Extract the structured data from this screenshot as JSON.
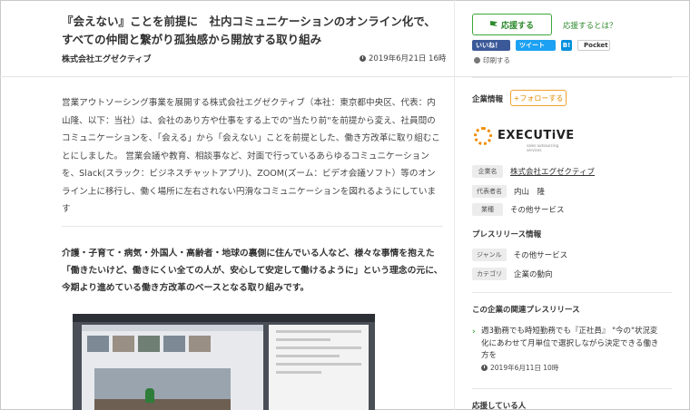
{
  "article": {
    "title": "『会えない』ことを前提に　社内コミュニケーションのオンライン化で、すべての仲間と繋がり孤独感から開放する取り組み",
    "company": "株式会社エグゼクティブ",
    "date": "2019年6月21日 16時",
    "lead": "営業アウトソーシング事業を展開する株式会社エグゼクティブ（本社：東京都中央区、代表：内山隆、以下：当社）は、会社のあり方や仕事をする上での\"当たり前\"を前提から変え、社員間のコミュニケーションを、「会える」から「会えない」ことを前提とした、働き方改革に取り組むことにしました。 営業会議や教育、相談事など、対面で行っているあらゆるコミュニケーションを、Slack(スラック：ビジネスチャットアプリ)、ZOOM(ズーム：ビデオ会議ソフト）等のオンライン上に移行し、働く場所に左右されない円滑なコミュニケーションを図れるようにしています",
    "bold_paragraph": "介護・子育て・病気・外国人・高齢者・地球の裏側に住んでいる人など、様々な事情を抱えた「働きたいけど、働きにくい全ての人が、安心して安定して働けるように」という理念の元に、今期より進めている働き方改革のベースとなる取り組みです。"
  },
  "sidebar": {
    "support_button": "応援する",
    "support_link": "応援するとは？",
    "social": {
      "facebook": "いいね！",
      "twitter": "ツイート",
      "hatena": "B!",
      "pocket": "Pocket"
    },
    "print": "印刷する",
    "company_info_title": "企業情報",
    "follow_button": "+フォローする",
    "logo_text": "EXECUTiVE",
    "logo_sub": "sales outsourcing services",
    "company_rows": [
      {
        "tag": "企業名",
        "value": "株式会社エグゼクティブ"
      },
      {
        "tag": "代表者名",
        "value": "内山　隆"
      },
      {
        "tag": "業種",
        "value": "その他サービス"
      }
    ],
    "press_info_title": "プレスリリース情報",
    "press_rows": [
      {
        "tag": "ジャンル",
        "value": "その他サービス"
      },
      {
        "tag": "カテゴリ",
        "value": "企業の動向"
      }
    ],
    "related_title": "この企業の関連プレスリリース",
    "related_item": "週3勤務でも時短勤務でも『正社員』 \"今の\"状況変化にあわせて月単位で選択しながら決定できる働き方を",
    "related_date": "2019年6月11日 10時",
    "next_section_title": "応援している人"
  }
}
